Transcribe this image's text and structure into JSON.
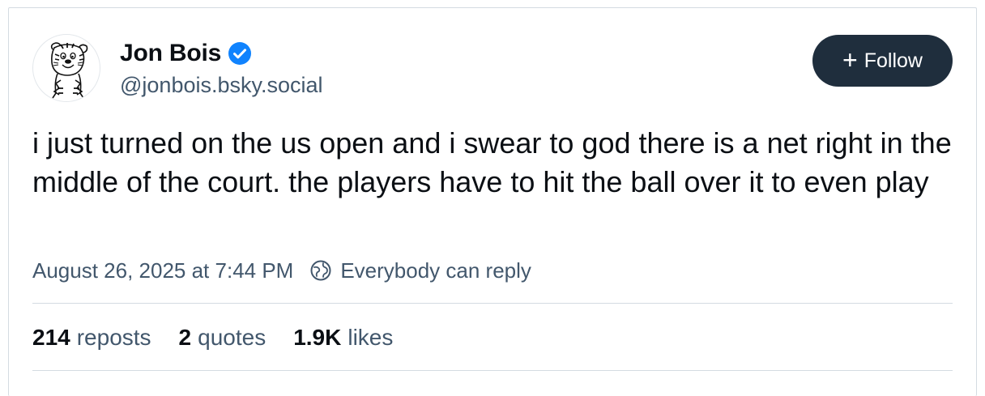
{
  "author": {
    "display_name": "Jon Bois",
    "handle": "@jonbois.bsky.social",
    "verified": true,
    "avatar_icon": "calvin-hobbes-tiger-avatar",
    "verified_icon": "verified-check-icon"
  },
  "follow_button": {
    "icon": "plus-icon",
    "label": "Follow"
  },
  "post": {
    "text": "i just turned on the us open and i swear to god there is a net right in the middle of the court. the players have to hit the ball over it to even play",
    "timestamp": "August 26, 2025 at 7:44 PM",
    "reply_setting_icon": "globe-icon",
    "reply_setting": "Everybody can reply"
  },
  "stats": {
    "reposts_count": "214",
    "reposts_label": "reposts",
    "quotes_count": "2",
    "quotes_label": "quotes",
    "likes_count": "1.9K",
    "likes_label": "likes"
  },
  "colors": {
    "text_primary": "#0b0f14",
    "text_secondary": "#42576c",
    "button_bg": "#1f2e3d",
    "verified_blue": "#1083fe",
    "divider": "#d4dbe2"
  }
}
